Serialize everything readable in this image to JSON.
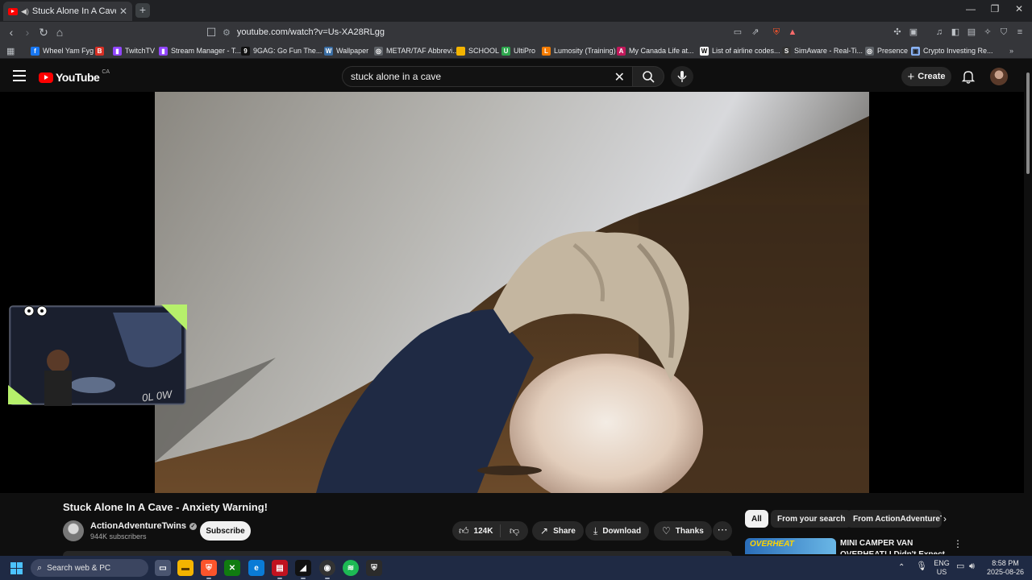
{
  "browser": {
    "tab_title": "Stuck Alone In A Cave - Anxi",
    "new_tab": "+",
    "url": "youtube.com/watch?v=Us-XA28RLgg",
    "bookmarks": [
      {
        "label": "Wheel Yam Fyg",
        "color": "#1877f2",
        "glyph": "f"
      },
      {
        "label": "",
        "color": "#d93025",
        "glyph": "B"
      },
      {
        "label": "TwitchTV",
        "color": "#9146ff",
        "glyph": "▮"
      },
      {
        "label": "Stream Manager - T...",
        "color": "#9146ff",
        "glyph": "▮"
      },
      {
        "label": "9GAG: Go Fun The...",
        "color": "#111111",
        "glyph": "9"
      },
      {
        "label": "Wallpaper",
        "color": "#3a6ea5",
        "glyph": "W"
      },
      {
        "label": "METAR/TAF Abbrevi...",
        "color": "#5f6368",
        "glyph": "◎"
      },
      {
        "label": "SCHOOL",
        "color": "#f4b400",
        "glyph": "▬"
      },
      {
        "label": "UltiPro",
        "color": "#2fa84f",
        "glyph": "U"
      },
      {
        "label": "Lumosity (Training)",
        "color": "#f57c00",
        "glyph": "L"
      },
      {
        "label": "My Canada Life at...",
        "color": "#c2185b",
        "glyph": "A"
      },
      {
        "label": "List of airline codes...",
        "color": "#ffffff",
        "glyph": "W"
      },
      {
        "label": "SimAware - Real-Ti...",
        "color": "#333333",
        "glyph": "S"
      },
      {
        "label": "Presence",
        "color": "#5f6368",
        "glyph": "◎"
      },
      {
        "label": "Crypto Investing Re...",
        "color": "#8ab4f8",
        "glyph": "▣"
      }
    ]
  },
  "youtube": {
    "logo": "YouTube",
    "country": "CA",
    "search_value": "stuck alone in a cave",
    "create_label": "Create"
  },
  "stream": {
    "overlay_text": "0L 0W"
  },
  "video": {
    "title": "Stuck Alone In A Cave - Anxiety Warning!",
    "channel": "ActionAdventureTwins",
    "verified": "✓",
    "subscribers": "944K subscribers",
    "subscribe_label": "Subscribe",
    "likes": "124K",
    "share_label": "Share",
    "download_label": "Download",
    "thanks_label": "Thanks",
    "more_label": "⋯"
  },
  "recommendations": {
    "chips": [
      "All",
      "From your search",
      "From ActionAdventureT"
    ],
    "first": {
      "thumb_text": "OVERHEAT",
      "title": "MINI CAMPER VAN OVERHEAT! I Didn't Expect THIS 😱"
    }
  },
  "taskbar": {
    "search_placeholder": "Search web & PC",
    "lang": "ENG",
    "region": "US",
    "time": "8:58 PM",
    "date": "2025-08-26"
  }
}
